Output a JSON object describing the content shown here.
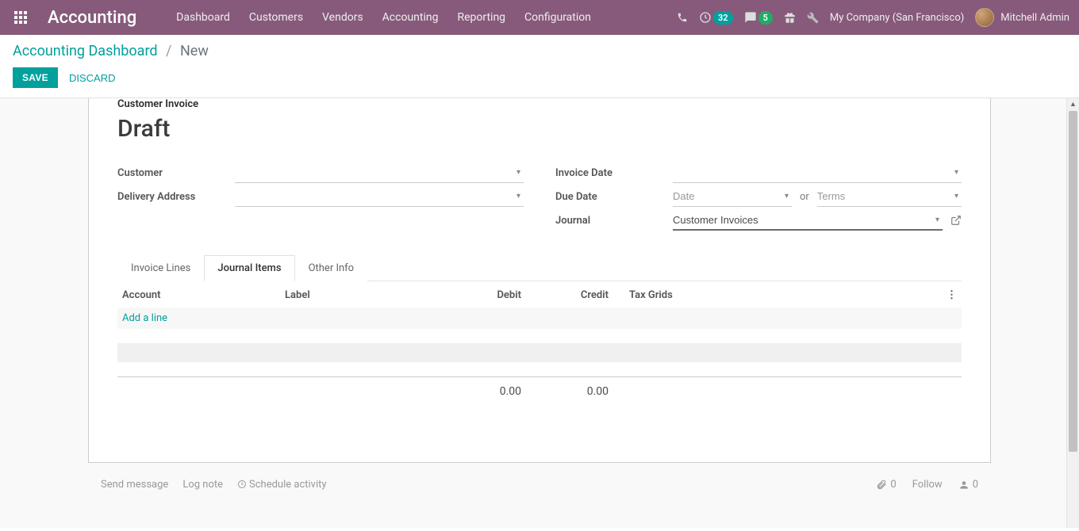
{
  "navbar": {
    "brand": "Accounting",
    "menu": [
      "Dashboard",
      "Customers",
      "Vendors",
      "Accounting",
      "Reporting",
      "Configuration"
    ],
    "tray": {
      "activities_badge": "32",
      "messages_badge": "5"
    },
    "company": "My Company (San Francisco)",
    "user": "Mitchell Admin"
  },
  "breadcrumb": {
    "parent": "Accounting Dashboard",
    "current": "New"
  },
  "buttons": {
    "save": "SAVE",
    "discard": "DISCARD"
  },
  "form": {
    "type_label": "Customer Invoice",
    "title": "Draft",
    "left_fields": {
      "customer_label": "Customer",
      "delivery_label": "Delivery Address"
    },
    "right_fields": {
      "invoice_date_label": "Invoice Date",
      "due_date_label": "Due Date",
      "due_date_placeholder": "Date",
      "due_or": "or",
      "terms_placeholder": "Terms",
      "journal_label": "Journal",
      "journal_value": "Customer Invoices"
    },
    "tabs": {
      "lines": "Invoice Lines",
      "journal": "Journal Items",
      "other": "Other Info"
    },
    "table": {
      "headers": {
        "account": "Account",
        "label": "Label",
        "debit": "Debit",
        "credit": "Credit",
        "tax": "Tax Grids"
      },
      "add_line": "Add a line",
      "total_debit": "0.00",
      "total_credit": "0.00"
    }
  },
  "chatter": {
    "send": "Send message",
    "log": "Log note",
    "schedule": "Schedule activity",
    "attach_count": "0",
    "follow": "Follow",
    "followers_count": "0"
  }
}
